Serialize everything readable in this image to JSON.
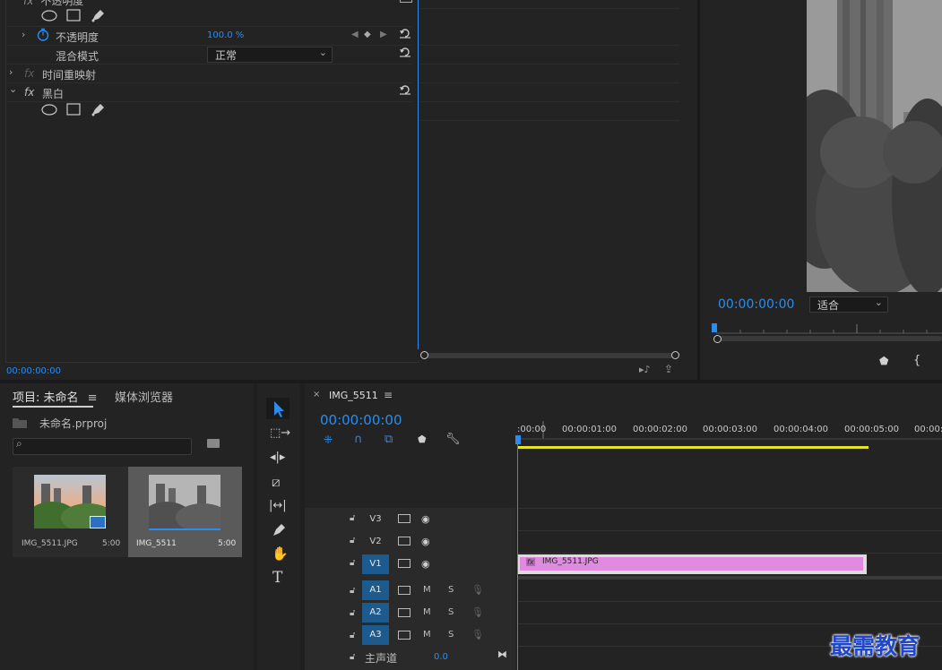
{
  "effect_controls": {
    "opacity_header": "不透明度",
    "opacity_label": "不透明度",
    "opacity_value": "100.0 %",
    "blend_label": "混合模式",
    "blend_value": "正常",
    "time_remap_label": "时间重映射",
    "bw_label": "黑白",
    "fx_label": "fx",
    "timecode": "00:00:00:00"
  },
  "program": {
    "timecode": "00:00:00:00",
    "fit_value": "适合"
  },
  "project": {
    "tab_project": "项目: 未命名",
    "tab_media": "媒体浏览器",
    "file_name": "未命名.prproj",
    "search_placeholder": "",
    "items": [
      {
        "name": "IMG_5511.JPG",
        "duration": "5:00"
      },
      {
        "name": "IMG_5511",
        "duration": "5:00"
      }
    ]
  },
  "timeline": {
    "sequence_name": "IMG_5511",
    "timecode": "00:00:00:00",
    "ruler": [
      ":00:00",
      "00:00:01:00",
      "00:00:02:00",
      "00:00:03:00",
      "00:00:04:00",
      "00:00:05:00",
      "00:00:0"
    ],
    "video_tracks": [
      "V3",
      "V2",
      "V1"
    ],
    "audio_tracks": [
      "A1",
      "A2",
      "A3"
    ],
    "mute_label": "M",
    "solo_label": "S",
    "master_label": "主声道",
    "master_value": "0.0",
    "clip_name": "IMG_5511.JPG",
    "clip_fx": "fx",
    "clip_color": "#e08be0"
  },
  "watermark": "最需教育",
  "colors": {
    "accent": "#2d8ceb",
    "work_area": "#e3e32a"
  }
}
